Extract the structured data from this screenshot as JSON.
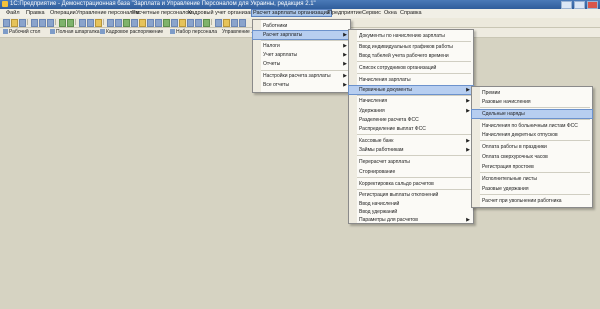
{
  "window": {
    "title": "1С:Предприятие - Демонстрационная база \"Зарплата и Управление Персоналом для Украины, редакция 2.1\""
  },
  "menubar": {
    "items": [
      "Файл",
      "Правка",
      "Операции",
      "Управление персоналом",
      "Расчетные персоналом",
      "Кадровый учет организаций",
      "Расчет зарплаты организаций",
      "Предприятие",
      "Сервис",
      "Окна",
      "Справка"
    ],
    "active_index": 6
  },
  "toolbar2": {
    "items": [
      "Рабочий стол",
      "Полная шпаргалка",
      "Кадровое распоряжение",
      "Набор персонала",
      "Управление ..."
    ]
  },
  "menu1": {
    "items": [
      {
        "label": "Работники",
        "arrow": false
      },
      {
        "label": "Расчет зарплаты",
        "arrow": true,
        "highlight": true
      },
      {
        "label": "Налоги",
        "arrow": true
      },
      {
        "label": "Учет зарплаты",
        "arrow": true
      },
      {
        "label": "Отчеты",
        "arrow": true
      },
      {
        "label": "Настройки расчета зарплаты",
        "arrow": true
      },
      {
        "label": "Все отчеты",
        "arrow": true
      }
    ]
  },
  "menu2": {
    "items": [
      {
        "label": "Документы по начислению зарплаты"
      },
      {
        "label": "Ввод индивидуальных графиков работы"
      },
      {
        "label": "Ввод табелей учета рабочего времени"
      },
      {
        "label": "Список сотрудников организаций"
      },
      {
        "label": "Начисления зарплаты"
      },
      {
        "label": "Первичные документы",
        "arrow": true,
        "highlight": true
      },
      {
        "label": "Начисления",
        "arrow": true
      },
      {
        "label": "Удержания",
        "arrow": true
      },
      {
        "label": "Разделение расчета ФСС"
      },
      {
        "label": "Распределение выплат ФСС"
      },
      {
        "label": "Кассовые банк",
        "arrow": true
      },
      {
        "label": "Займы работникам",
        "arrow": true
      },
      {
        "label": "Перерасчет зарплаты"
      },
      {
        "label": "Сторнирование"
      },
      {
        "label": "Корректировка сальдо расчетов"
      },
      {
        "label": "Регистрация выплаты отклонений"
      },
      {
        "label": "Ввод начислений"
      },
      {
        "label": "Ввод удержаний"
      },
      {
        "label": "Параметры для расчетов",
        "arrow": true
      }
    ]
  },
  "menu3": {
    "items": [
      {
        "label": "Премии"
      },
      {
        "label": "Разовые начисления"
      },
      {
        "label": "Сдельные наряды",
        "highlight": true
      },
      {
        "label": "Начисления по больничным листам ФСС"
      },
      {
        "label": "Начисления декретных отпусков"
      },
      {
        "label": "Оплата работы в праздники"
      },
      {
        "label": "Оплата сверхурочных часов"
      },
      {
        "label": "Регистрация простоев"
      },
      {
        "label": "Исполнительные листы"
      },
      {
        "label": "Разовые удержания"
      },
      {
        "label": "Расчет при увольнении работника"
      }
    ]
  }
}
